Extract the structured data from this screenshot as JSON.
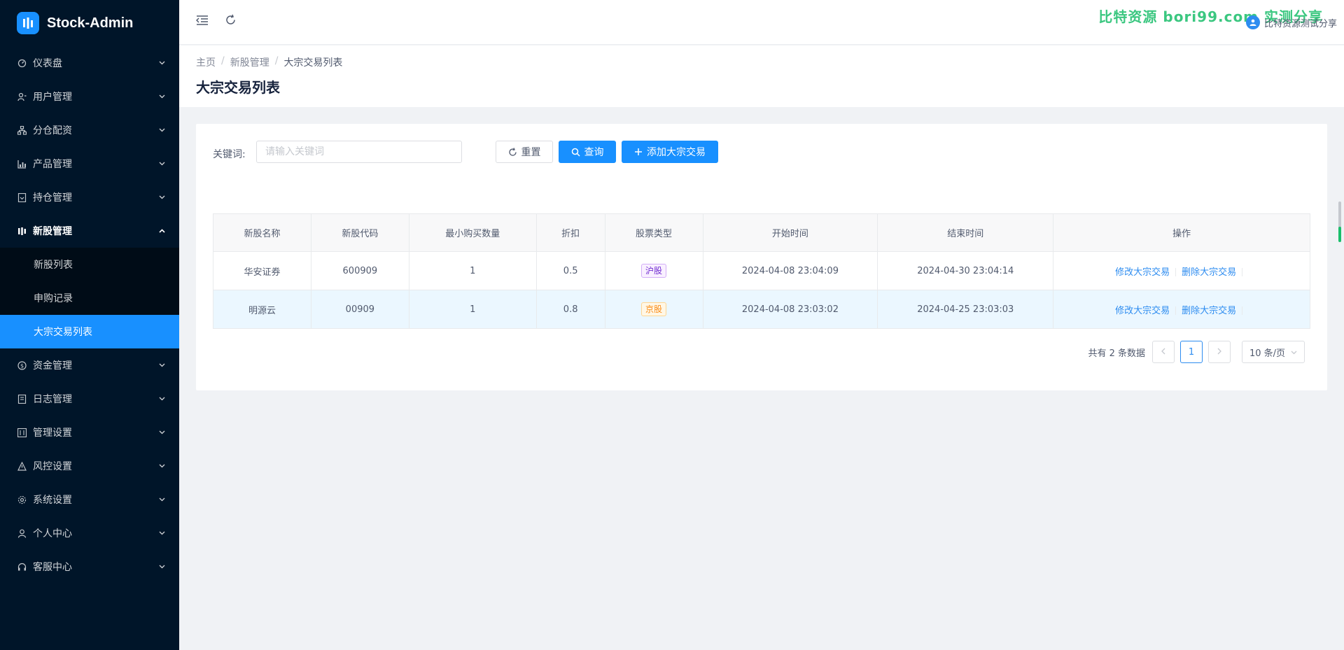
{
  "app": {
    "title": "Stock-Admin"
  },
  "sidebar": {
    "items": [
      {
        "label": "仪表盘",
        "icon": "dashboard-icon"
      },
      {
        "label": "用户管理",
        "icon": "user-manage-icon"
      },
      {
        "label": "分仓配资",
        "icon": "sitemap-icon"
      },
      {
        "label": "产品管理",
        "icon": "chart-icon"
      },
      {
        "label": "持仓管理",
        "icon": "position-icon"
      },
      {
        "label": "新股管理",
        "icon": "ipo-icon"
      },
      {
        "label": "资金管理",
        "icon": "money-icon"
      },
      {
        "label": "日志管理",
        "icon": "log-icon"
      },
      {
        "label": "管理设置",
        "icon": "admin-settings-icon"
      },
      {
        "label": "风控设置",
        "icon": "warning-icon"
      },
      {
        "label": "系统设置",
        "icon": "gear-icon"
      },
      {
        "label": "个人中心",
        "icon": "person-icon"
      },
      {
        "label": "客服中心",
        "icon": "headset-icon"
      }
    ],
    "sub_items": [
      "新股列表",
      "申购记录",
      "大宗交易列表"
    ]
  },
  "header": {
    "watermark": "比特资源 bori99.com 实测分享",
    "user_name": "比特资源测试分享"
  },
  "breadcrumb": [
    "主页",
    "新股管理",
    "大宗交易列表"
  ],
  "page_title": "大宗交易列表",
  "search": {
    "label": "关键词:",
    "placeholder": "请输入关键词",
    "value": "",
    "reset_label": "重置",
    "query_label": "查询",
    "add_label": "添加大宗交易"
  },
  "table": {
    "columns": [
      "新股名称",
      "新股代码",
      "最小购买数量",
      "折扣",
      "股票类型",
      "开始时间",
      "结束时间",
      "操作"
    ],
    "rows": [
      {
        "name": "华安证券",
        "code": "600909",
        "min_qty": "1",
        "discount": "0.5",
        "type": "沪股",
        "type_color": "purple",
        "start": "2024-04-08 23:04:09",
        "end": "2024-04-30 23:04:14",
        "edit": "修改大宗交易",
        "delete": "删除大宗交易"
      },
      {
        "name": "明源云",
        "code": "00909",
        "min_qty": "1",
        "discount": "0.8",
        "type": "京股",
        "type_color": "orange",
        "start": "2024-04-08 23:03:02",
        "end": "2024-04-25 23:03:03",
        "edit": "修改大宗交易",
        "delete": "删除大宗交易"
      }
    ]
  },
  "pagination": {
    "total_text": "共有 2 条数据",
    "current_page": "1",
    "page_size": "10 条/页"
  },
  "colors": {
    "sidebar_bg": "#001529",
    "accent": "#1890ff",
    "link": "#2d8cf0"
  }
}
